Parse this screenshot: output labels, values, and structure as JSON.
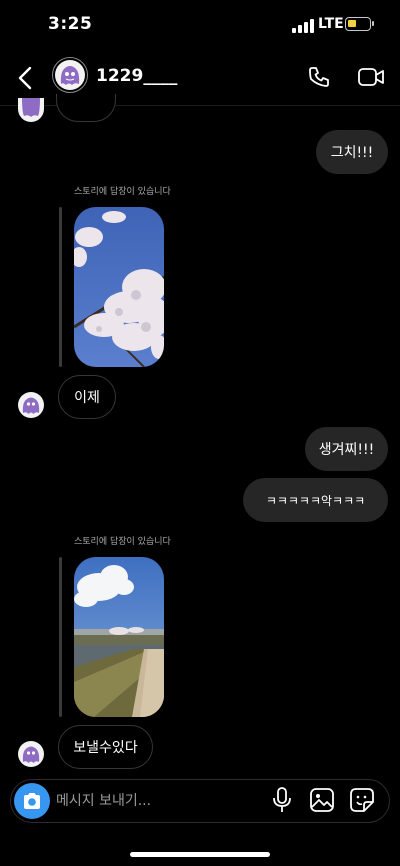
{
  "status_bar": {
    "time": "3:25",
    "network": "LTE",
    "battery_color": "#f4d03f"
  },
  "header": {
    "username": "1229____"
  },
  "messages": {
    "sent_1": "그치!!!",
    "story_reply_caption_1": "스토리에 답장이 있습니다",
    "received_1": "이제",
    "sent_2": "생겨찌!!!",
    "sent_3": "ㅋㅋㅋㅋㅋ악ㅋㅋㅋ",
    "story_reply_caption_2": "스토리에 답장이 있습니다",
    "received_2": "보낼수있다"
  },
  "composer": {
    "placeholder": "메시지 보내기..."
  },
  "colors": {
    "accent": "#3797f0",
    "bubble_sent": "#262626",
    "background": "#000000"
  }
}
